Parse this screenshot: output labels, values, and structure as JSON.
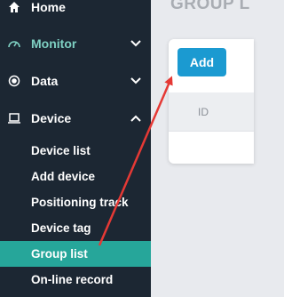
{
  "sidebar": {
    "items": [
      {
        "label": "Home",
        "icon": "home-icon"
      },
      {
        "label": "Monitor",
        "icon": "gauge-icon",
        "chevron": "chevron-down-icon"
      },
      {
        "label": "Data",
        "icon": "radio-dot-icon",
        "chevron": "chevron-down-icon"
      },
      {
        "label": "Device",
        "icon": "laptop-icon",
        "chevron": "chevron-up-icon"
      }
    ],
    "device_submenu": [
      {
        "label": "Device list"
      },
      {
        "label": "Add device"
      },
      {
        "label": "Positioning track"
      },
      {
        "label": "Device tag"
      },
      {
        "label": "Group list",
        "selected": true
      },
      {
        "label": "On-line record"
      }
    ]
  },
  "main": {
    "page_title": "GROUP L",
    "add_button_label": "Add",
    "table": {
      "headers": [
        "ID"
      ]
    }
  },
  "colors": {
    "sidebar_bg": "#1c2733",
    "selected_item_bg": "#26a69a",
    "monitor_text": "#7ecfc2",
    "add_button_bg": "#1b9ad1",
    "annotation_arrow": "#e53935"
  }
}
